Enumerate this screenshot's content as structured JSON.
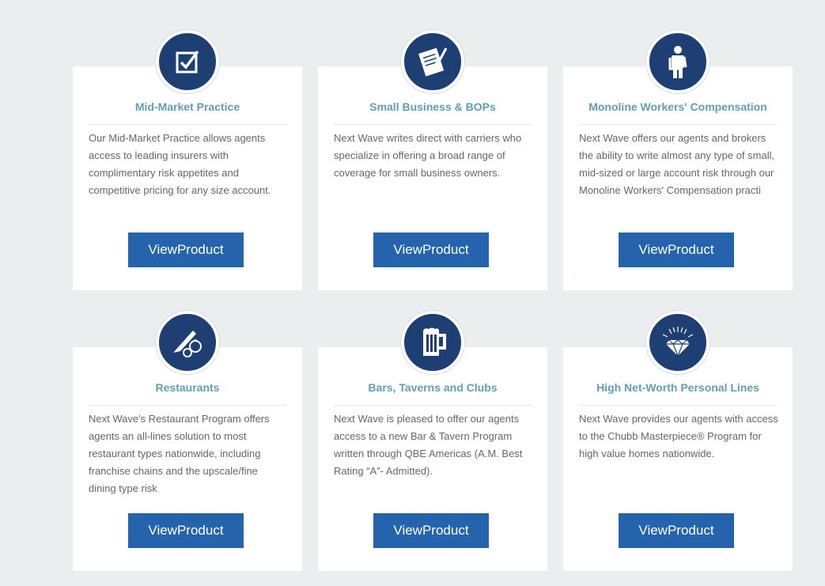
{
  "products": [
    {
      "title": "Mid-Market Practice",
      "icon": "checkbox-icon",
      "description": "Our Mid-Market Practice allows agents access to leading insurers with complimentary risk appetites and competitive pricing for any size account.",
      "button_label": "ViewProduct"
    },
    {
      "title": "Small Business & BOPs",
      "icon": "document-pen-icon",
      "description": "Next Wave writes direct with carriers who specialize in offering a broad range of coverage for small business owners.",
      "button_label": "ViewProduct"
    },
    {
      "title": "Monoline Workers' Compensation",
      "icon": "injured-worker-icon",
      "description": "Next Wave offers our agents and brokers the ability to write almost any type of small, mid-sized or large account risk through our Monoline Workers' Compensation practi",
      "button_label": "ViewProduct"
    },
    {
      "title": "Restaurants",
      "icon": "knife-vegetables-icon",
      "description": "Next Wave's Restaurant Program offers agents an all-lines solution to most restaurant types nationwide, including franchise chains and the upscale/fine dining type risk",
      "button_label": "ViewProduct"
    },
    {
      "title": "Bars, Taverns and Clubs",
      "icon": "beer-mug-icon",
      "description": "Next Wave is pleased to offer our agents access to a new Bar & Tavern Program written through QBE Americas (A.M. Best Rating “A”- Admitted).",
      "button_label": "ViewProduct"
    },
    {
      "title": "High Net-Worth Personal Lines",
      "icon": "diamond-icon",
      "description": "Next Wave provides our agents with access to the Chubb Masterpiece® Program for high value homes nationwide.",
      "button_label": "ViewProduct"
    }
  ],
  "colors": {
    "background": "#ebeeef",
    "card": "#ffffff",
    "badge": "#1d3f73",
    "title": "#5f9fb1",
    "button": "#2563ad"
  }
}
